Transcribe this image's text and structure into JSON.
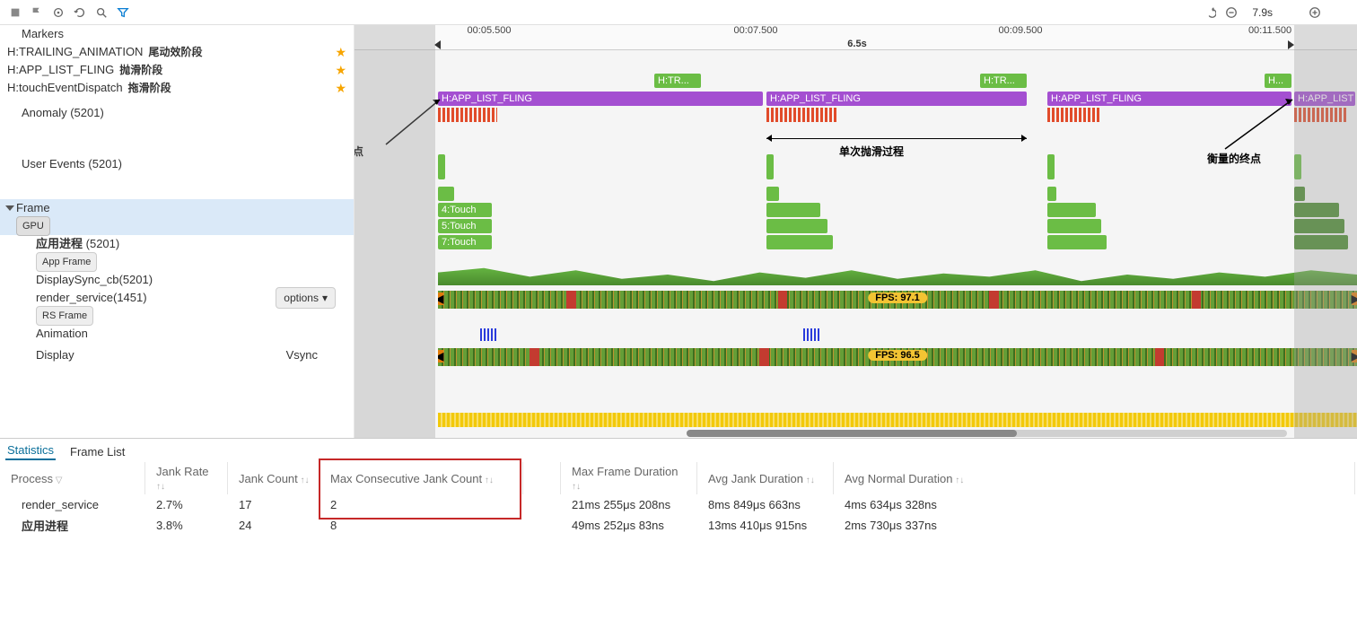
{
  "toolbar": {
    "duration": "7.9s"
  },
  "time_header": {
    "ticks": [
      "00:05.500",
      "00:07.500",
      "00:09.500",
      "00:11.500"
    ],
    "tick_pos": [
      150,
      447,
      742,
      1020
    ],
    "range_label": "6.5s"
  },
  "sidebar": {
    "markers_label": "Markers",
    "rows": [
      {
        "name": "H:TRAILING_ANIMATION",
        "cn": "尾动效阶段"
      },
      {
        "name": "H:APP_LIST_FLING",
        "cn": "抛滑阶段"
      },
      {
        "name": "H:touchEventDispatch",
        "cn": "拖滑阶段"
      }
    ],
    "anomaly": "Anomaly (5201)",
    "user_events": "User Events (5201)",
    "frame": "Frame",
    "gpu": "GPU",
    "proc1": "应用进程",
    "proc1_id": "(5201)",
    "app_frame": "App Frame",
    "display_sync": "DisplaySync_cb(5201)",
    "render_service": "render_service(1451)",
    "rs_frame": "RS Frame",
    "options": "options",
    "animation": "Animation",
    "display": "Display",
    "vsync": "Vsync"
  },
  "timeline": {
    "htr": "H:TR...",
    "hdot": "H...",
    "fling": "H:APP_LIST_FLING",
    "fling_short": "H:APP_LIST",
    "touch4": "4:Touch",
    "touch5": "5:Touch",
    "touch7": "7:Touch",
    "fps1": "FPS: 97.1",
    "fps2": "FPS: 96.5"
  },
  "annotations": {
    "start": "衡量的起点",
    "single": "单次抛滑过程",
    "end": "衡量的终点"
  },
  "bottom": {
    "tabs": {
      "statistics": "Statistics",
      "frame_list": "Frame List"
    },
    "columns": [
      "Process",
      "Jank Rate",
      "Jank Count",
      "Max Consecutive Jank Count",
      "Max Frame Duration",
      "Avg Jank Duration",
      "Avg Normal Duration"
    ],
    "rows": [
      {
        "process": "render_service",
        "jank_rate": "2.7%",
        "jank_count": "17",
        "max_cons": "2",
        "max_dur": "21ms 255μs 208ns",
        "avg_jank": "8ms 849μs 663ns",
        "avg_norm": "4ms 634μs 328ns"
      },
      {
        "process": "应用进程",
        "jank_rate": "3.8%",
        "jank_count": "24",
        "max_cons": "8",
        "max_dur": "49ms 252μs 83ns",
        "avg_jank": "13ms 410μs 915ns",
        "avg_norm": "2ms 730μs 337ns"
      }
    ]
  }
}
